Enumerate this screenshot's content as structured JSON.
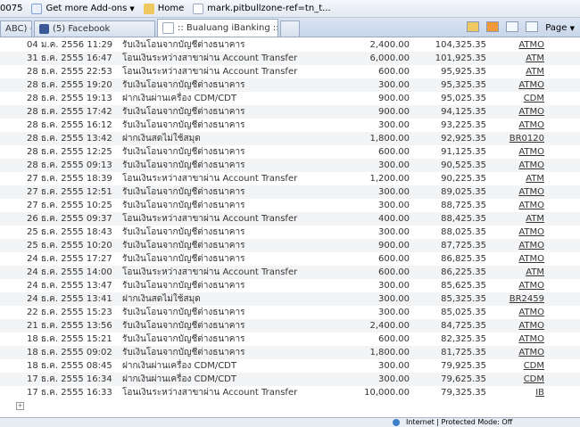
{
  "favorites_bar": {
    "items": [
      {
        "label": "0075"
      },
      {
        "label": "Get more Add-ons"
      },
      {
        "label": "Home"
      },
      {
        "label": "mark.pitbullzone-ref=tn_t..."
      }
    ]
  },
  "tabs": [
    {
      "label": "ABC) - ..."
    },
    {
      "label": "(5) Facebook"
    },
    {
      "label": ":: Bualuang iBanking ::"
    }
  ],
  "command_bar": {
    "page_label": "Page"
  },
  "transactions": [
    {
      "date": "04 ม.ค. 2556 11:29",
      "desc": "รับเงินโอนจากบัญชีต่างธนาคาร",
      "amount": "2,400.00",
      "balance": "104,325.35",
      "channel": "ATMO"
    },
    {
      "date": "31 ธ.ค. 2555 16:47",
      "desc": "โอนเงินระหว่างสาขาผ่าน Account Transfer",
      "amount": "6,000.00",
      "balance": "101,925.35",
      "channel": "ATM"
    },
    {
      "date": "28 ธ.ค. 2555 22:53",
      "desc": "โอนเงินระหว่างสาขาผ่าน Account Transfer",
      "amount": "600.00",
      "balance": "95,925.35",
      "channel": "ATM"
    },
    {
      "date": "28 ธ.ค. 2555 19:20",
      "desc": "รับเงินโอนจากบัญชีต่างธนาคาร",
      "amount": "300.00",
      "balance": "95,325.35",
      "channel": "ATMO"
    },
    {
      "date": "28 ธ.ค. 2555 19:13",
      "desc": "ฝากเงินผ่านเครื่อง CDM/CDT",
      "amount": "900.00",
      "balance": "95,025.35",
      "channel": "CDM"
    },
    {
      "date": "28 ธ.ค. 2555 17:42",
      "desc": "รับเงินโอนจากบัญชีต่างธนาคาร",
      "amount": "900.00",
      "balance": "94,125.35",
      "channel": "ATMO"
    },
    {
      "date": "28 ธ.ค. 2555 16:12",
      "desc": "รับเงินโอนจากบัญชีต่างธนาคาร",
      "amount": "300.00",
      "balance": "93,225.35",
      "channel": "ATMO"
    },
    {
      "date": "28 ธ.ค. 2555 13:42",
      "desc": "ฝากเงินสดไม่ใช้สมุด",
      "amount": "1,800.00",
      "balance": "92,925.35",
      "channel": "BR0120"
    },
    {
      "date": "28 ธ.ค. 2555 12:25",
      "desc": "รับเงินโอนจากบัญชีต่างธนาคาร",
      "amount": "600.00",
      "balance": "91,125.35",
      "channel": "ATMO"
    },
    {
      "date": "28 ธ.ค. 2555 09:13",
      "desc": "รับเงินโอนจากบัญชีต่างธนาคาร",
      "amount": "300.00",
      "balance": "90,525.35",
      "channel": "ATMO"
    },
    {
      "date": "27 ธ.ค. 2555 18:39",
      "desc": "โอนเงินระหว่างสาขาผ่าน Account Transfer",
      "amount": "1,200.00",
      "balance": "90,225.35",
      "channel": "ATM"
    },
    {
      "date": "27 ธ.ค. 2555 12:51",
      "desc": "รับเงินโอนจากบัญชีต่างธนาคาร",
      "amount": "300.00",
      "balance": "89,025.35",
      "channel": "ATMO"
    },
    {
      "date": "27 ธ.ค. 2555 10:25",
      "desc": "รับเงินโอนจากบัญชีต่างธนาคาร",
      "amount": "300.00",
      "balance": "88,725.35",
      "channel": "ATMO"
    },
    {
      "date": "26 ธ.ค. 2555 09:37",
      "desc": "โอนเงินระหว่างสาขาผ่าน Account Transfer",
      "amount": "400.00",
      "balance": "88,425.35",
      "channel": "ATM"
    },
    {
      "date": "25 ธ.ค. 2555 18:43",
      "desc": "รับเงินโอนจากบัญชีต่างธนาคาร",
      "amount": "300.00",
      "balance": "88,025.35",
      "channel": "ATMO"
    },
    {
      "date": "25 ธ.ค. 2555 10:20",
      "desc": "รับเงินโอนจากบัญชีต่างธนาคาร",
      "amount": "900.00",
      "balance": "87,725.35",
      "channel": "ATMO"
    },
    {
      "date": "24 ธ.ค. 2555 17:27",
      "desc": "รับเงินโอนจากบัญชีต่างธนาคาร",
      "amount": "600.00",
      "balance": "86,825.35",
      "channel": "ATMO"
    },
    {
      "date": "24 ธ.ค. 2555 14:00",
      "desc": "โอนเงินระหว่างสาขาผ่าน Account Transfer",
      "amount": "600.00",
      "balance": "86,225.35",
      "channel": "ATM"
    },
    {
      "date": "24 ธ.ค. 2555 13:47",
      "desc": "รับเงินโอนจากบัญชีต่างธนาคาร",
      "amount": "300.00",
      "balance": "85,625.35",
      "channel": "ATMO"
    },
    {
      "date": "24 ธ.ค. 2555 13:41",
      "desc": "ฝากเงินสดไม่ใช้สมุด",
      "amount": "300.00",
      "balance": "85,325.35",
      "channel": "BR2459"
    },
    {
      "date": "22 ธ.ค. 2555 15:23",
      "desc": "รับเงินโอนจากบัญชีต่างธนาคาร",
      "amount": "300.00",
      "balance": "85,025.35",
      "channel": "ATMO"
    },
    {
      "date": "21 ธ.ค. 2555 13:56",
      "desc": "รับเงินโอนจากบัญชีต่างธนาคาร",
      "amount": "2,400.00",
      "balance": "84,725.35",
      "channel": "ATMO"
    },
    {
      "date": "18 ธ.ค. 2555 15:21",
      "desc": "รับเงินโอนจากบัญชีต่างธนาคาร",
      "amount": "600.00",
      "balance": "82,325.35",
      "channel": "ATMO"
    },
    {
      "date": "18 ธ.ค. 2555 09:02",
      "desc": "รับเงินโอนจากบัญชีต่างธนาคาร",
      "amount": "1,800.00",
      "balance": "81,725.35",
      "channel": "ATMO"
    },
    {
      "date": "18 ธ.ค. 2555 08:45",
      "desc": "ฝากเงินผ่านเครื่อง CDM/CDT",
      "amount": "300.00",
      "balance": "79,925.35",
      "channel": "CDM"
    },
    {
      "date": "17 ธ.ค. 2555 16:34",
      "desc": "ฝากเงินผ่านเครื่อง CDM/CDT",
      "amount": "300.00",
      "balance": "79,625.35",
      "channel": "CDM"
    },
    {
      "date": "17 ธ.ค. 2555 16:33",
      "desc": "โอนเงินระหว่างสาขาผ่าน Account Transfer",
      "amount": "10,000.00",
      "balance": "79,325.35",
      "channel": "IB"
    }
  ],
  "status_bar": {
    "text": "Internet | Protected Mode: Off"
  }
}
